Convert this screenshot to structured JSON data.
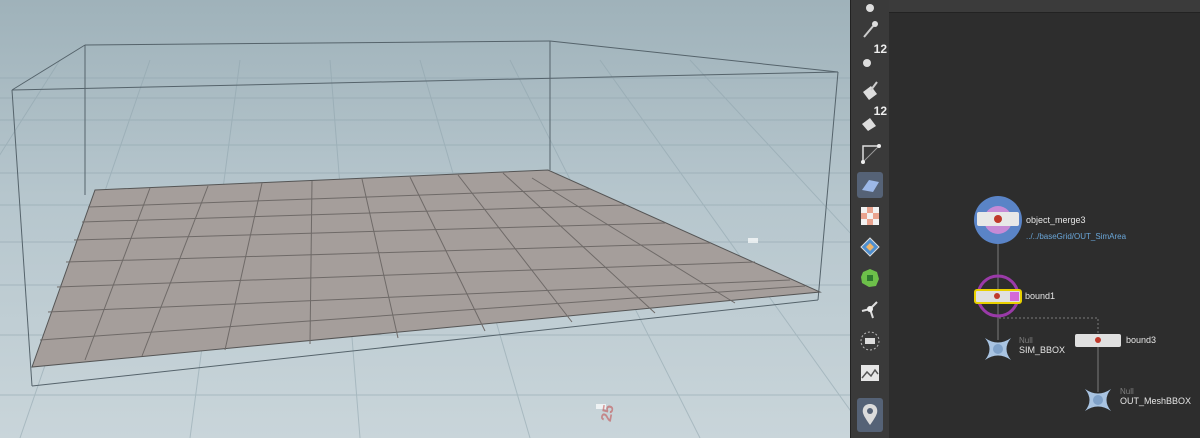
{
  "viewport": {
    "axis_label": "25"
  },
  "shelf": {
    "tools": [
      {
        "icon": "sphere-pin-icon",
        "active": false,
        "badge": ""
      },
      {
        "icon": "pin-icon",
        "active": false,
        "badge": ""
      },
      {
        "icon": "spheres-count-icon",
        "active": false,
        "badge": "12"
      },
      {
        "icon": "paint-bucket-icon",
        "active": false,
        "badge": ""
      },
      {
        "icon": "paint-bucket-count-icon",
        "active": false,
        "badge": "12"
      },
      {
        "icon": "curve-corner-icon",
        "active": false,
        "badge": ""
      },
      {
        "icon": "plane-icon",
        "active": true,
        "badge": ""
      },
      {
        "icon": "checker-texture-icon",
        "active": false,
        "badge": ""
      },
      {
        "icon": "diamond-marker-icon",
        "active": false,
        "badge": ""
      },
      {
        "icon": "green-shape-icon",
        "active": false,
        "badge": ""
      },
      {
        "icon": "pivot-handle-icon",
        "active": false,
        "badge": ""
      },
      {
        "icon": "ring-select-icon",
        "active": false,
        "badge": ""
      },
      {
        "icon": "terrain-image-icon",
        "active": false,
        "badge": ""
      },
      {
        "icon": "location-pin-icon",
        "active": true,
        "badge": ""
      }
    ]
  },
  "network": {
    "nodes": {
      "object_merge3": {
        "name": "object_merge3",
        "path": "../../baseGrid/OUT_SimArea"
      },
      "bound1": {
        "name": "bound1"
      },
      "sim_bbox": {
        "name": "SIM_BBOX",
        "type": "Null"
      },
      "bound3": {
        "name": "bound3"
      },
      "out_meshbbox": {
        "name": "OUT_MeshBBOX",
        "type": "Null"
      }
    }
  },
  "colors": {
    "viewport_bg": "#b6c6cd",
    "grid_plane": "#a59e9b",
    "network_bg": "#2d2d2d",
    "selected_node": "#e8d000",
    "merge_node_ring": "#5a84c7",
    "merge_node_inner": "#c68ad6"
  }
}
